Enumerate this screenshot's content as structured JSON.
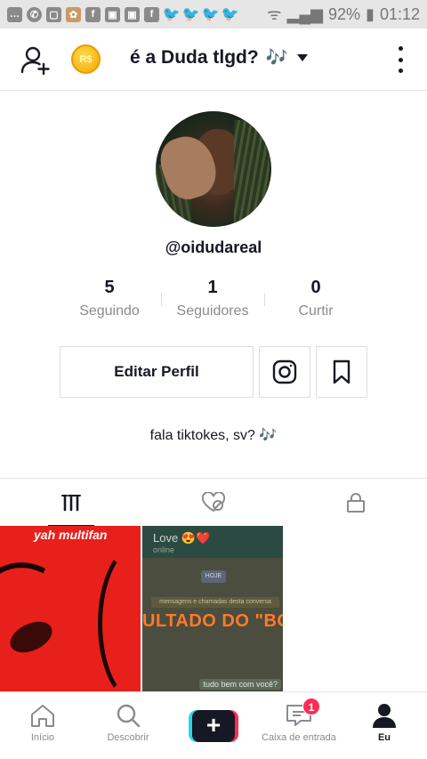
{
  "status_bar": {
    "battery": "92%",
    "time": "01:12"
  },
  "header": {
    "title": "é a Duda tlgd?",
    "title_emoji": "🎶",
    "coin_label": "R$"
  },
  "profile": {
    "username": "@oidudareal",
    "stats": [
      {
        "value": "5",
        "label": "Seguindo"
      },
      {
        "value": "1",
        "label": "Seguidores"
      },
      {
        "value": "0",
        "label": "Curtir"
      }
    ],
    "edit_button": "Editar Perfil",
    "bio_text": "fala tiktokes, sv?",
    "bio_emoji": "🎶"
  },
  "videos": [
    {
      "caption": "yah multifan"
    },
    {
      "chat_title": "Love 😍❤️",
      "chat_status": "online",
      "date_chip": "HOJE",
      "system_msg": "mensagens e chamadas desta conversa",
      "overlay": "ULTADO DO \"BO",
      "bubble": "tudo bem com você?"
    }
  ],
  "bottom_nav": [
    {
      "label": "Início"
    },
    {
      "label": "Descobrir"
    },
    {
      "label": "+"
    },
    {
      "label": "Caixa de entrada",
      "badge": "1"
    },
    {
      "label": "Eu"
    }
  ],
  "colors": {
    "accent": "#fe2c55",
    "accent2": "#27d7e6",
    "text": "#161823",
    "muted": "#8a8b91",
    "coin": "#f5a800"
  }
}
